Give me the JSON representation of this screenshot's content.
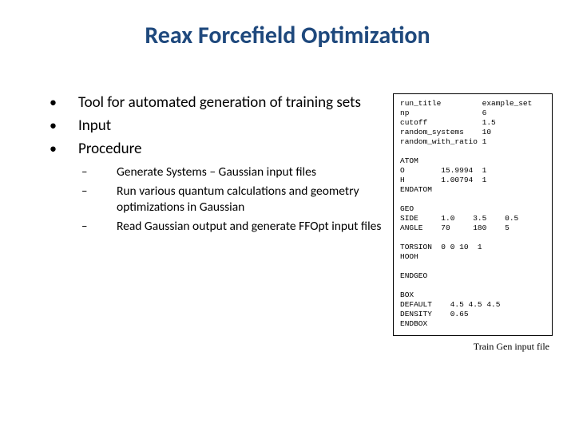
{
  "title": "Reax Forcefield Optimization",
  "bullets": [
    "Tool for automated generation of training sets",
    "Input",
    "Procedure"
  ],
  "sub_bullets": [
    "Generate Systems – Gaussian input files",
    "Run various quantum calculations and geometry optimizations in Gaussian",
    "Read Gaussian output and generate FFOpt input files"
  ],
  "code": "run_title         example_set\nnp                6\ncutoff            1.5\nrandom_systems    10\nrandom_with_ratio 1\n\nATOM\nO        15.9994  1\nH        1.00794  1\nENDATOM\n\nGEO\nSIDE     1.0    3.5    0.5\nANGLE    70     180    5\n\nTORSION  0 0 10  1\nHOOH\n\nENDGEO\n\nBOX\nDEFAULT    4.5 4.5 4.5\nDENSITY    0.65\nENDBOX",
  "caption": "Train Gen input file"
}
